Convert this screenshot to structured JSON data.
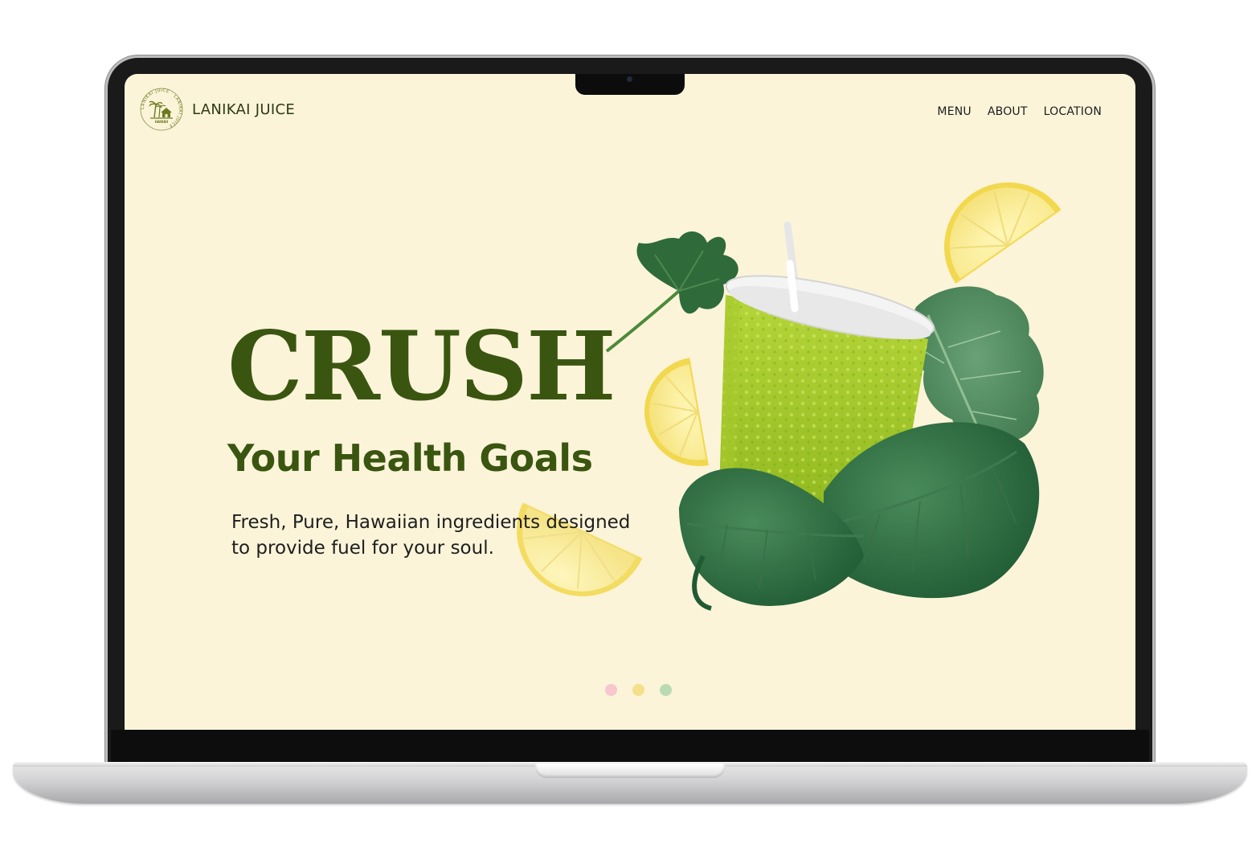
{
  "brand": {
    "name": "LANIKAI JUICE",
    "seal_text": "LANIKAI JUICE · LANIKAI JUICE ·",
    "seal_sub": "HAWAII",
    "accent": "#6b7a1e"
  },
  "nav": {
    "items": [
      {
        "label": "MENU"
      },
      {
        "label": "ABOUT"
      },
      {
        "label": "LOCATION"
      }
    ]
  },
  "hero": {
    "title": "CRUSH",
    "subtitle": "Your Health Goals",
    "description": "Fresh, Pure, Hawaiian ingredients designed to provide fuel for your soul."
  },
  "carousel": {
    "dots": [
      {
        "color": "#f7c6cf"
      },
      {
        "color": "#f5df8a"
      },
      {
        "color": "#b9dbb4"
      }
    ]
  },
  "colors": {
    "background": "#fbf4d9",
    "heading": "#3a5510",
    "text": "#1e1e1e"
  },
  "icons": {
    "logo": "lanikai-seal-icon",
    "artwork": "green-smoothie-cup-with-lemons-spinach-kale"
  }
}
